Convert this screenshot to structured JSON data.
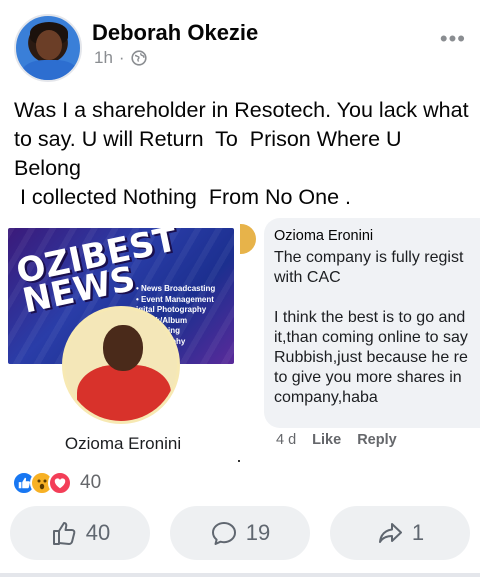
{
  "post": {
    "author": "Deborah Okezie",
    "time": "1h",
    "separator": "·",
    "audience_icon": "globe-icon",
    "more_label": "•••",
    "text": "Was I a shareholder in Resotech. You lack what to say. U will Return  To  Prison Where U Belong\n I collected Nothing  From No One ."
  },
  "image_left": {
    "brand_line1": "OZIBEST",
    "brand_line2": "NEWS",
    "services": [
      "• News Broadcasting",
      "• Event Management",
      "igital Photography",
      "obook/Album",
      "Retouching",
      "Photography",
      "overage"
    ],
    "caption": "Ozioma Eronini"
  },
  "image_right": {
    "commenter": "Ozioma Eronini",
    "comment_text": "The company is fully regist\nwith CAC\n\nI think the best is to go and\nit,than coming online to say\nRubbish,just because he re\nto give you more shares in\ncompany,haba",
    "time": "4 d",
    "like_label": "Like",
    "reply_label": "Reply"
  },
  "reactions": {
    "icons": [
      "like-icon",
      "wow-icon",
      "love-icon"
    ],
    "count": "40"
  },
  "actions": {
    "like_count": "40",
    "comment_count": "19",
    "share_count": "1"
  },
  "colors": {
    "brand_blue": "#1877f2",
    "button_bg": "#eef0f2",
    "muted_text": "#65676b"
  }
}
